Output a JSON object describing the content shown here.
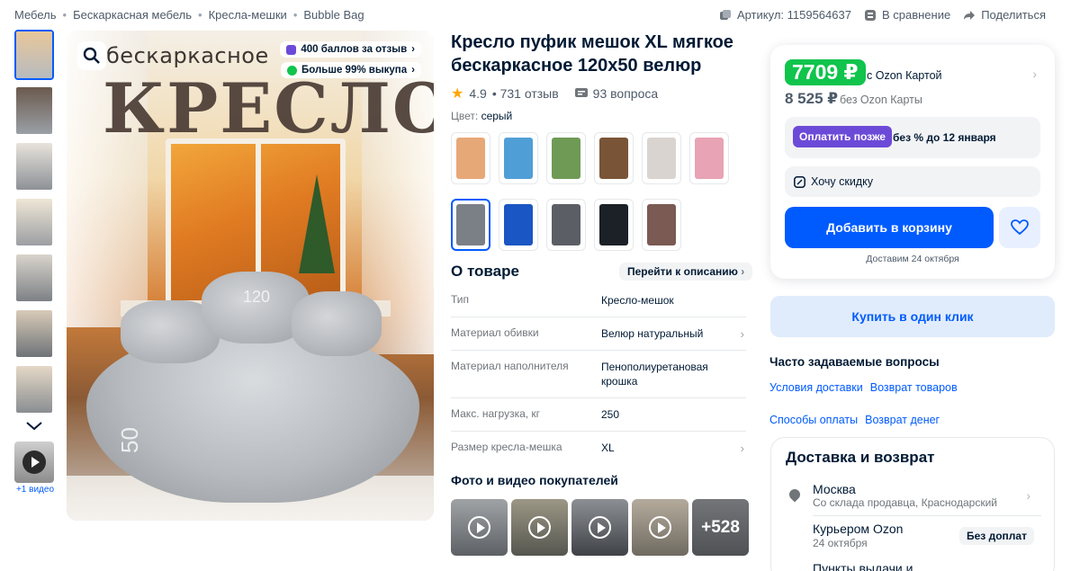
{
  "breadcrumb": [
    "Мебель",
    "Бескаркасная мебель",
    "Кресла-мешки",
    "Bubble Bag"
  ],
  "top_actions": {
    "article": "Артикул: 1159564637",
    "compare": "В сравнение",
    "share": "Поделиться"
  },
  "gallery": {
    "video_caption": "+1 видео",
    "overlay_line1": "бескаркасное",
    "overlay_line2": "КРЕСЛО",
    "label_120": "120",
    "label_50": "50",
    "badge_points": "400 баллов за отзыв",
    "badge_buyout": "Больше 99% выкупа"
  },
  "product": {
    "title": "Кресло пуфик мешок XL мягкое бескаркасное 120х50 велюр",
    "rating": "4.9",
    "reviews": "• 731 отзыв",
    "questions": "93 вопроса",
    "color_label": "Цвет:",
    "color_value": "серый",
    "swatch_colors": [
      "#e7a878",
      "#4f9fd6",
      "#6e9a55",
      "#7a5436",
      "#d9d4cf",
      "#e8a3b4",
      "#7b8087",
      "#1a56c4",
      "#5c5e66",
      "#1c2128",
      "#7a5a52"
    ],
    "selected_swatch": 6
  },
  "about": {
    "heading": "О товаре",
    "link": "Перейти к описанию",
    "specs": [
      {
        "k": "Тип",
        "v": "Кресло-мешок"
      },
      {
        "k": "Материал обивки",
        "v": "Велюр натуральный"
      },
      {
        "k": "Материал наполнителя",
        "v": "Пенополиуретановая крошка"
      },
      {
        "k": "Макс. нагрузка, кг",
        "v": "250"
      },
      {
        "k": "Размер кресла-мешка",
        "v": "XL"
      }
    ]
  },
  "photos": {
    "heading": "Фото и видео покупателей",
    "more": "+528"
  },
  "price": {
    "ozon_price": "7709 ₽",
    "ozon_caption": "с Ozon Картой",
    "regular_price": "8 525 ₽",
    "regular_caption": "без Ozon Карты",
    "pay_later_button": "Оплатить позже",
    "pay_later_text": "без % до 12 января",
    "discount": "Хочу скидку",
    "add_to_cart": "Добавить в корзину",
    "delivery_date": "Доставим 24 октября"
  },
  "one_click": "Купить в один клик",
  "faq": {
    "heading": "Часто задаваемые вопросы",
    "links": [
      "Условия доставки",
      "Возврат товаров",
      "Способы оплаты",
      "Возврат денег"
    ]
  },
  "delivery": {
    "heading": "Доставка и возврат",
    "city": "Москва",
    "source": "Со склада продавца, Краснодарский",
    "courier": "Курьером Ozon",
    "courier_date": "24 октября",
    "courier_tag": "Без доплат",
    "points": "Пункты выдачи и"
  },
  "colors": {
    "accent": "#005bff",
    "ozon_green": "#10c44c",
    "pay_later": "#6c4ad8"
  }
}
